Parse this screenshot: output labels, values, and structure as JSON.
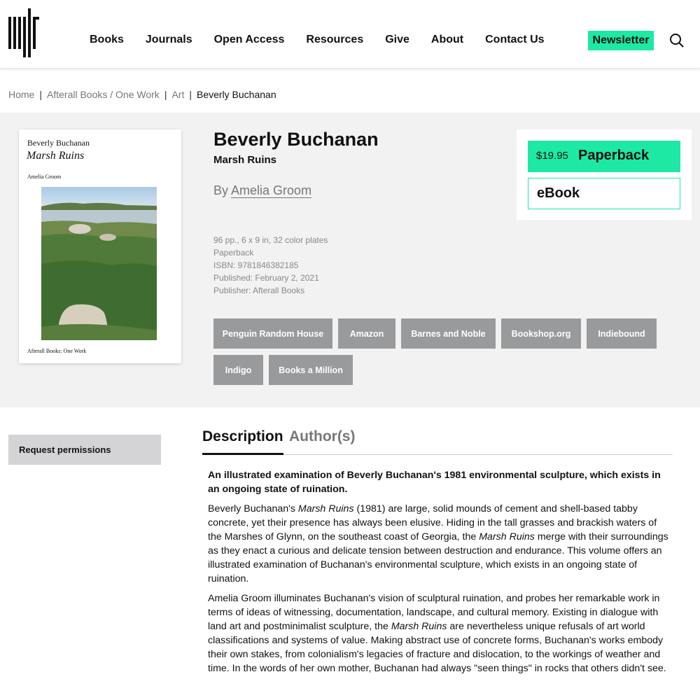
{
  "header": {
    "logo_icon": "mit-press-logo-icon",
    "nav": [
      "Books",
      "Journals",
      "Open Access",
      "Resources",
      "Give",
      "About",
      "Contact Us"
    ],
    "newsletter_label": "Newsletter",
    "search_icon": "search-icon",
    "accent_color": "#1de9a4"
  },
  "breadcrumb": {
    "items": [
      "Home",
      "Afterall Books / One Work",
      "Art"
    ],
    "current": "Beverly Buchanan",
    "separator": "|"
  },
  "book": {
    "title": "Beverly Buchanan",
    "subtitle": "Marsh Ruins",
    "by_prefix": "By",
    "author": "Amelia Groom",
    "meta": [
      "96 pp., 6 x 9 in, 32 color plates",
      "Paperback",
      "ISBN: 9781846382185",
      "Published: February 2, 2021",
      "Publisher: Afterall Books"
    ],
    "cover": {
      "author": "Beverly Buchanan",
      "title": "Marsh Ruins",
      "byline": "Amelia Groom",
      "series": "Afterall Books: One Work"
    }
  },
  "buy": {
    "paperback_price": "$19.95",
    "paperback_label": "Paperback",
    "ebook_label": "eBook"
  },
  "retailers": [
    "Penguin Random House",
    "Amazon",
    "Barnes and Noble",
    "Bookshop.org",
    "Indiebound",
    "Indigo",
    "Books a Million"
  ],
  "sidebar": {
    "permissions_label": "Request permissions"
  },
  "tabs": {
    "description": "Description",
    "authors": "Author(s)"
  },
  "description": {
    "lead": "An illustrated examination of Beverly Buchanan's 1981 environmental sculpture, which exists in an ongoing state of ruination.",
    "p1_a": "Beverly Buchanan's ",
    "p1_em1": "Marsh Ruins",
    "p1_b": " (1981) are large, solid mounds of cement and shell-based tabby concrete, yet their presence has always been elusive. Hiding in the tall grasses and brackish waters of the Marshes of Glynn, on the southeast coast of Georgia, the ",
    "p1_em2": "Marsh Ruins",
    "p1_c": " merge with their surroundings as they enact a curious and delicate tension between destruction and endurance. This volume offers an illustrated examination of Buchanan's environmental sculpture, which exists in an ongoing state of ruination.",
    "p2_a": "Amelia Groom illuminates Buchanan's vision of sculptural ruination, and probes her remarkable work in terms of ideas of witnessing, documentation, landscape, and cultural memory. Existing in dialogue with land art and postminimalist sculpture, the ",
    "p2_em": "Marsh Ruins",
    "p2_b": " are nevertheless unique refusals of art world classifications and systems of value. Making abstract use of concrete forms, Buchanan's works embody their own stakes, from colonialism's legacies of fracture and dislocation, to the workings of weather and time. In the words of her own mother, Buchanan had always \"seen things\" in rocks that others didn't see."
  }
}
